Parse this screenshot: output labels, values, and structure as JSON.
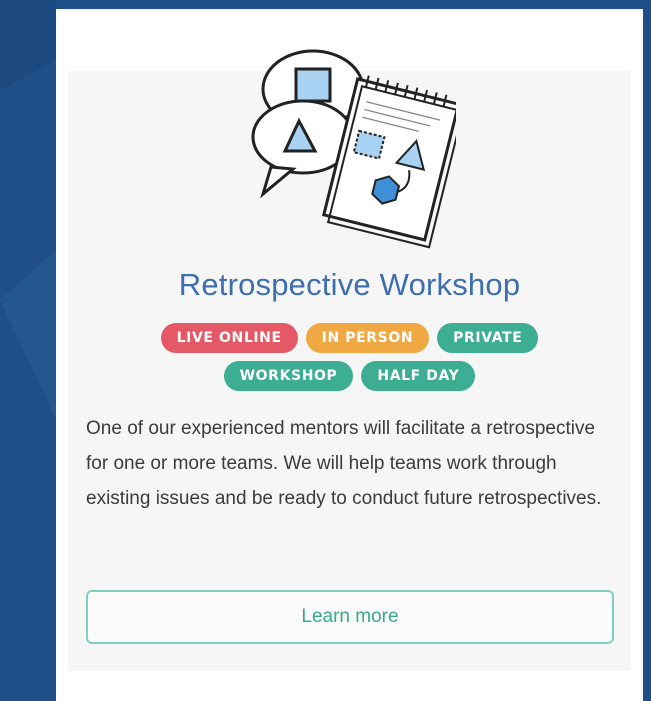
{
  "card": {
    "title": "Retrospective Workshop",
    "tags": [
      {
        "label": "LIVE ONLINE",
        "color": "#e55866"
      },
      {
        "label": "IN PERSON",
        "color": "#f0a842"
      },
      {
        "label": "PRIVATE",
        "color": "#3dae94"
      },
      {
        "label": "WORKSHOP",
        "color": "#3dae94"
      },
      {
        "label": "HALF DAY",
        "color": "#3dae94"
      }
    ],
    "description": "One of our experienced mentors will facilitate a retrospective for one or more teams. We will help teams work through existing issues and be ready to conduct future retrospectives.",
    "learn_more_label": "Learn more",
    "illustration_icon": "notebook-with-shapes-icon"
  },
  "colors": {
    "page_background": "#1f4f86",
    "title": "#3d6fb0",
    "button_border": "#7fd0bf",
    "button_text": "#3aa88e"
  }
}
